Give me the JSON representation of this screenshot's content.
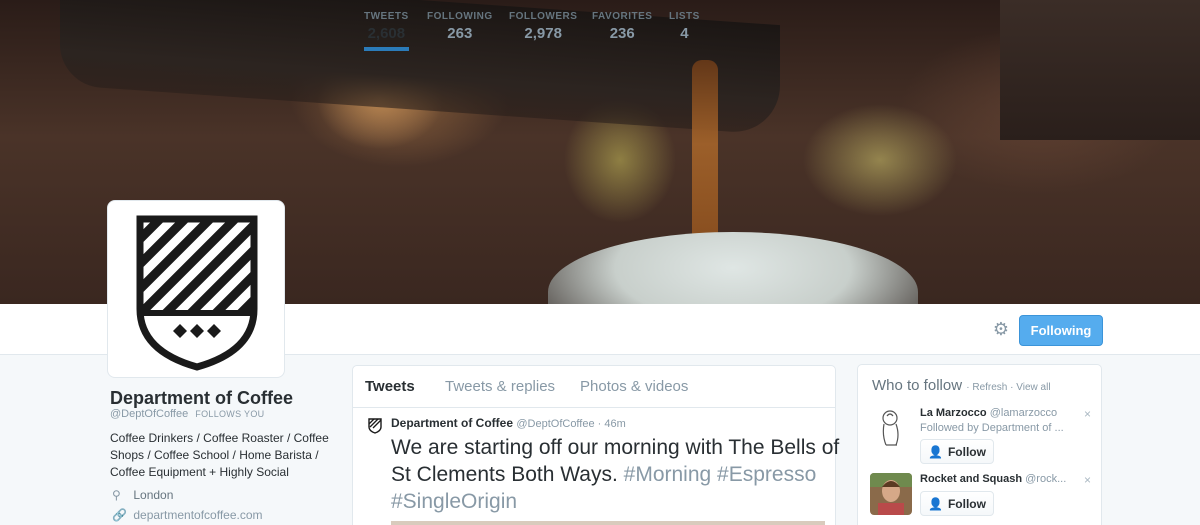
{
  "profile": {
    "name": "Department of Coffee",
    "handle": "@DeptOfCoffee",
    "follows_you": "FOLLOWS YOU",
    "bio": "Coffee Drinkers / Coffee Roaster / Coffee Shops / Coffee School / Home Barista / Coffee Equipment + Highly Social",
    "location": "London",
    "url": "departmentofcoffee.com"
  },
  "stats": [
    {
      "label": "TWEETS",
      "value": "2,608"
    },
    {
      "label": "FOLLOWING",
      "value": "263"
    },
    {
      "label": "FOLLOWERS",
      "value": "2,978"
    },
    {
      "label": "FAVORITES",
      "value": "236"
    },
    {
      "label": "LISTS",
      "value": "4"
    }
  ],
  "actions": {
    "following_label": "Following",
    "settings_icon": "gear-icon"
  },
  "timeline": {
    "tabs": [
      "Tweets",
      "Tweets & replies",
      "Photos & videos"
    ],
    "tweet": {
      "name": "Department of Coffee",
      "handle": "@DeptOfCoffee · 46m",
      "text": "We are starting off our morning with The Bells of St Clements Both Ways.",
      "tags": [
        "#Morning",
        "#Espresso",
        "#SingleOrigin"
      ]
    }
  },
  "who_to_follow": {
    "title": "Who to follow",
    "refresh": "Refresh",
    "view_all": "View all",
    "dot": "·",
    "suggestions": [
      {
        "name": "La Marzocco",
        "handle": "@lamarzocco",
        "context": "Followed by Department of ...",
        "button": "Follow"
      },
      {
        "name": "Rocket and Squash",
        "handle": "@rock...",
        "context": "",
        "button": "Follow"
      }
    ],
    "dismiss": "×"
  },
  "colors": {
    "accent": "#55acee",
    "link": "#2b7bb9"
  }
}
